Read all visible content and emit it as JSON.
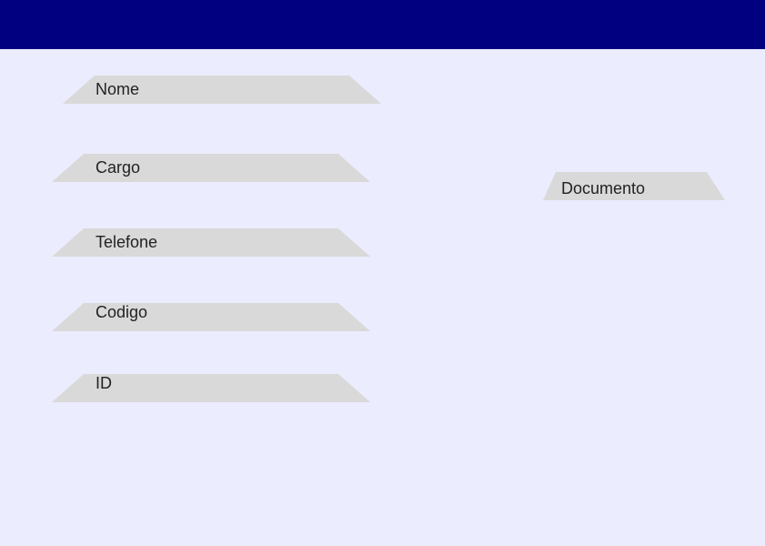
{
  "header": {
    "color": "#000080"
  },
  "form": {
    "fields": [
      {
        "key": "nome",
        "label": "Nome"
      },
      {
        "key": "cargo",
        "label": "Cargo"
      },
      {
        "key": "telefone",
        "label": "Telefone"
      },
      {
        "key": "codigo",
        "label": "Codigo"
      },
      {
        "key": "id",
        "label": "ID"
      },
      {
        "key": "documento",
        "label": "Documento"
      }
    ]
  },
  "colors": {
    "background": "#ececff",
    "field": "#d9d9d9",
    "text": "#222222"
  }
}
